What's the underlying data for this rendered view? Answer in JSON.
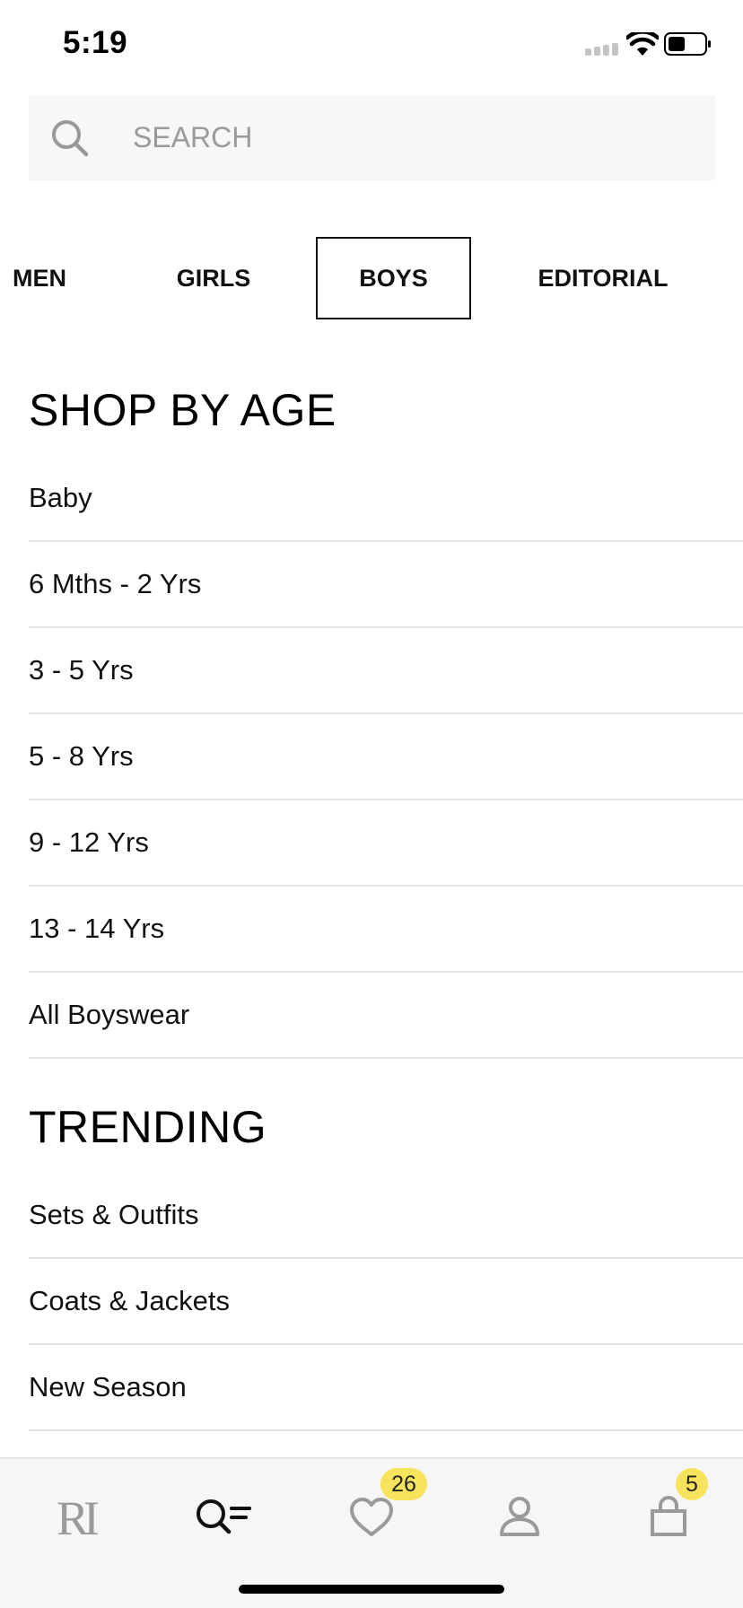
{
  "status_bar": {
    "time": "5:19"
  },
  "search": {
    "placeholder": "SEARCH",
    "icon": "search-icon"
  },
  "tabs": [
    {
      "label": "MEN",
      "active": false
    },
    {
      "label": "GIRLS",
      "active": false
    },
    {
      "label": "BOYS",
      "active": true
    },
    {
      "label": "EDITORIAL",
      "active": false
    }
  ],
  "sections": {
    "shop_by_age": {
      "title": "SHOP BY AGE",
      "items": [
        "Baby",
        "6 Mths - 2 Yrs",
        "3 - 5 Yrs",
        "5 - 8 Yrs",
        "9 - 12 Yrs",
        "13 - 14 Yrs",
        "All Boyswear"
      ]
    },
    "trending": {
      "title": "TRENDING",
      "items": [
        "Sets & Outfits",
        "Coats & Jackets",
        "New Season"
      ]
    }
  },
  "bottom_nav": {
    "home_logo": "RI",
    "home_icon": "ri-logo-icon",
    "search_icon": "search-menu-icon",
    "wishlist_icon": "heart-icon",
    "wishlist_count": "26",
    "account_icon": "person-icon",
    "bag_icon": "shopping-bag-icon",
    "bag_count": "5"
  },
  "colors": {
    "badge": "#f7e35c",
    "search_bg": "#f7f7f7",
    "divider": "#e3e3e3",
    "nav_bg": "#f6f6f6"
  }
}
